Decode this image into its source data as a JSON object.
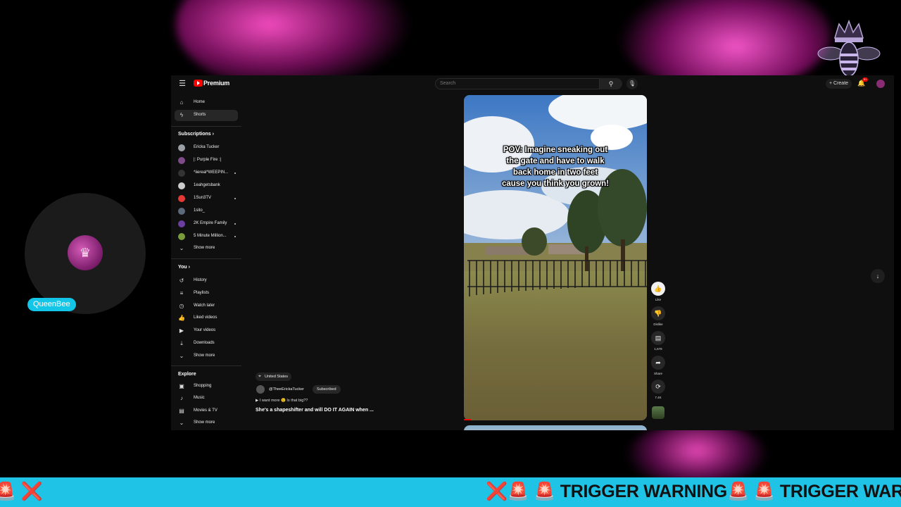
{
  "overlay": {
    "webcam_name": "QueenBee",
    "ticker_left": "🚨 ❌",
    "ticker_main": "❌🚨 🚨 TRIGGER WARNING🚨 🚨 TRIGGER WARN"
  },
  "youtube": {
    "logo_text": "Premium",
    "search_placeholder": "Search",
    "create_label": "+ Create",
    "notif_count": "9+",
    "sidebar": {
      "nav": [
        {
          "label": "Home",
          "icon": "home-icon"
        },
        {
          "label": "Shorts",
          "icon": "shorts-icon",
          "active": true
        }
      ],
      "subscriptions_header": "Subscriptions",
      "subscriptions": [
        {
          "label": "Ericka Tucker",
          "color": "#9aa0a6"
        },
        {
          "label": "|: Purple Fire :|",
          "color": "#7e4b8a"
        },
        {
          "label": "*iiereal*WEEPIN...",
          "color": "#333333"
        },
        {
          "label": "1eahgetsbank",
          "color": "#cccccc"
        },
        {
          "label": "1Sun3TV",
          "color": "#e53935"
        },
        {
          "label": "1sito_",
          "color": "#5a6a7a"
        },
        {
          "label": "2K Empire Family",
          "color": "#6a3fa0"
        },
        {
          "label": "5 Minute Million...",
          "color": "#7b9a3a"
        }
      ],
      "subs_show_more": "Show more",
      "you_header": "You",
      "you_items": [
        {
          "label": "History",
          "icon": "history-icon"
        },
        {
          "label": "Playlists",
          "icon": "playlists-icon"
        },
        {
          "label": "Watch later",
          "icon": "watch-later-icon"
        },
        {
          "label": "Liked videos",
          "icon": "liked-videos-icon"
        },
        {
          "label": "Your videos",
          "icon": "your-videos-icon"
        },
        {
          "label": "Downloads",
          "icon": "downloads-icon"
        },
        {
          "label": "Show more",
          "icon": "chevron-down-icon"
        }
      ],
      "explore_header": "Explore",
      "explore_items": [
        {
          "label": "Shopping",
          "icon": "shopping-icon"
        },
        {
          "label": "Music",
          "icon": "music-icon"
        },
        {
          "label": "Movies & TV",
          "icon": "movies-icon"
        },
        {
          "label": "Show more",
          "icon": "chevron-down-icon"
        }
      ]
    },
    "short": {
      "location": "United States",
      "channel": "@TheeErickaTucker",
      "subscribe_label": "Subscribed",
      "music": "I want more 😉 Is that big??",
      "title": "She's a shapeshifter and will DO IT AGAIN when ...",
      "overlay_text": "POV: Imagine sneaking out\nthe gate and have to walk\nback home in two feet\ncause you think you grown!",
      "actions": {
        "like": "Like",
        "dislike": "Dislike",
        "comments": "1,578",
        "share": "Share",
        "remix": "7.4K"
      }
    }
  }
}
